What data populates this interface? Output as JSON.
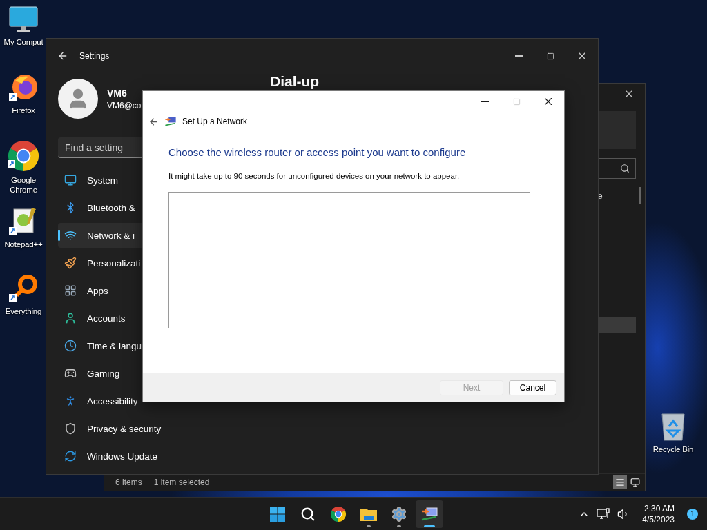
{
  "desktop_icons": [
    {
      "label": "My Comput",
      "kind": "computer",
      "shortcut": false
    },
    {
      "label": "Firefox",
      "kind": "firefox",
      "shortcut": true
    },
    {
      "label": "Google Chrome",
      "kind": "chrome",
      "shortcut": true
    },
    {
      "label": "Notepad++",
      "kind": "notepad",
      "shortcut": true
    },
    {
      "label": "Everything",
      "kind": "everything",
      "shortcut": true
    }
  ],
  "recycle_bin": {
    "label": "Recycle Bin"
  },
  "explorer_window": {
    "column_text": "e",
    "status_bar": [
      "6 items",
      "1 item selected"
    ],
    "views": [
      {
        "kind": "details",
        "selected": true
      },
      {
        "kind": "preview",
        "selected": false
      }
    ]
  },
  "settings_window": {
    "title": "Settings",
    "user": {
      "name": "VM6",
      "email": "VM6@co"
    },
    "search": {
      "placeholder": "Find a setting"
    },
    "page_title": "Dial-up",
    "nav": [
      {
        "label": "System",
        "kind": "system",
        "selected": false
      },
      {
        "label": "Bluetooth &",
        "kind": "bluetooth",
        "selected": false
      },
      {
        "label": "Network & i",
        "kind": "network",
        "selected": true
      },
      {
        "label": "Personalizati",
        "kind": "personalization",
        "selected": false
      },
      {
        "label": "Apps",
        "kind": "apps",
        "selected": false
      },
      {
        "label": "Accounts",
        "kind": "accounts",
        "selected": false
      },
      {
        "label": "Time & langu",
        "kind": "time",
        "selected": false
      },
      {
        "label": "Gaming",
        "kind": "gaming",
        "selected": false
      },
      {
        "label": "Accessibility",
        "kind": "accessibility",
        "selected": false
      },
      {
        "label": "Privacy & security",
        "kind": "privacy",
        "selected": false
      },
      {
        "label": "Windows Update",
        "kind": "update",
        "selected": false
      }
    ]
  },
  "dialog": {
    "title": "Set Up a Network",
    "heading": "Choose the wireless router or access point you want to configure",
    "description": "It might take up to 90 seconds for unconfigured devices on your network to appear.",
    "maximize_disabled": true,
    "buttons": [
      {
        "label": "Next",
        "disabled": true
      },
      {
        "label": "Cancel",
        "disabled": false
      }
    ]
  },
  "taskbar": {
    "apps": [
      {
        "kind": "start",
        "running": false,
        "active": false
      },
      {
        "kind": "search",
        "running": false,
        "active": false
      },
      {
        "kind": "chrome",
        "running": false,
        "active": false
      },
      {
        "kind": "folder",
        "running": true,
        "active": false
      },
      {
        "kind": "settings",
        "running": true,
        "active": false
      },
      {
        "kind": "network",
        "running": true,
        "active": true
      }
    ],
    "clock": {
      "time": "2:30 AM",
      "date": "4/5/2023"
    },
    "notifications": "1"
  }
}
